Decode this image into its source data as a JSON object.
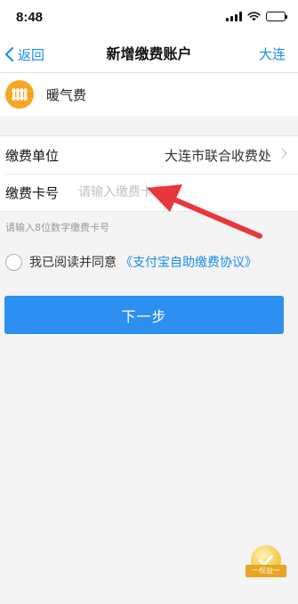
{
  "status_bar": {
    "time": "8:48"
  },
  "nav": {
    "back_label": "返回",
    "title": "新增缴费账户",
    "right_label": "大连"
  },
  "bill_type": {
    "label": "暖气费",
    "icon": "radiator-icon",
    "icon_color": "#f6a623"
  },
  "form": {
    "unit_label": "缴费单位",
    "unit_value": "大连市联合收费处",
    "card_label": "缴费卡号",
    "card_value": "",
    "card_placeholder": "请输入缴费卡号"
  },
  "hint": "请输入8位数字缴费卡号",
  "agreement": {
    "prefix": "我已阅读并同意",
    "link": "《支付宝自助缴费协议》",
    "checked": false
  },
  "next_button_label": "下一步",
  "badge": {
    "label": "一权益一"
  },
  "colors": {
    "accent": "#1a8cf0",
    "button": "#2d8ff0",
    "annotation": "#e8373a",
    "background": "#f4f4f5"
  }
}
